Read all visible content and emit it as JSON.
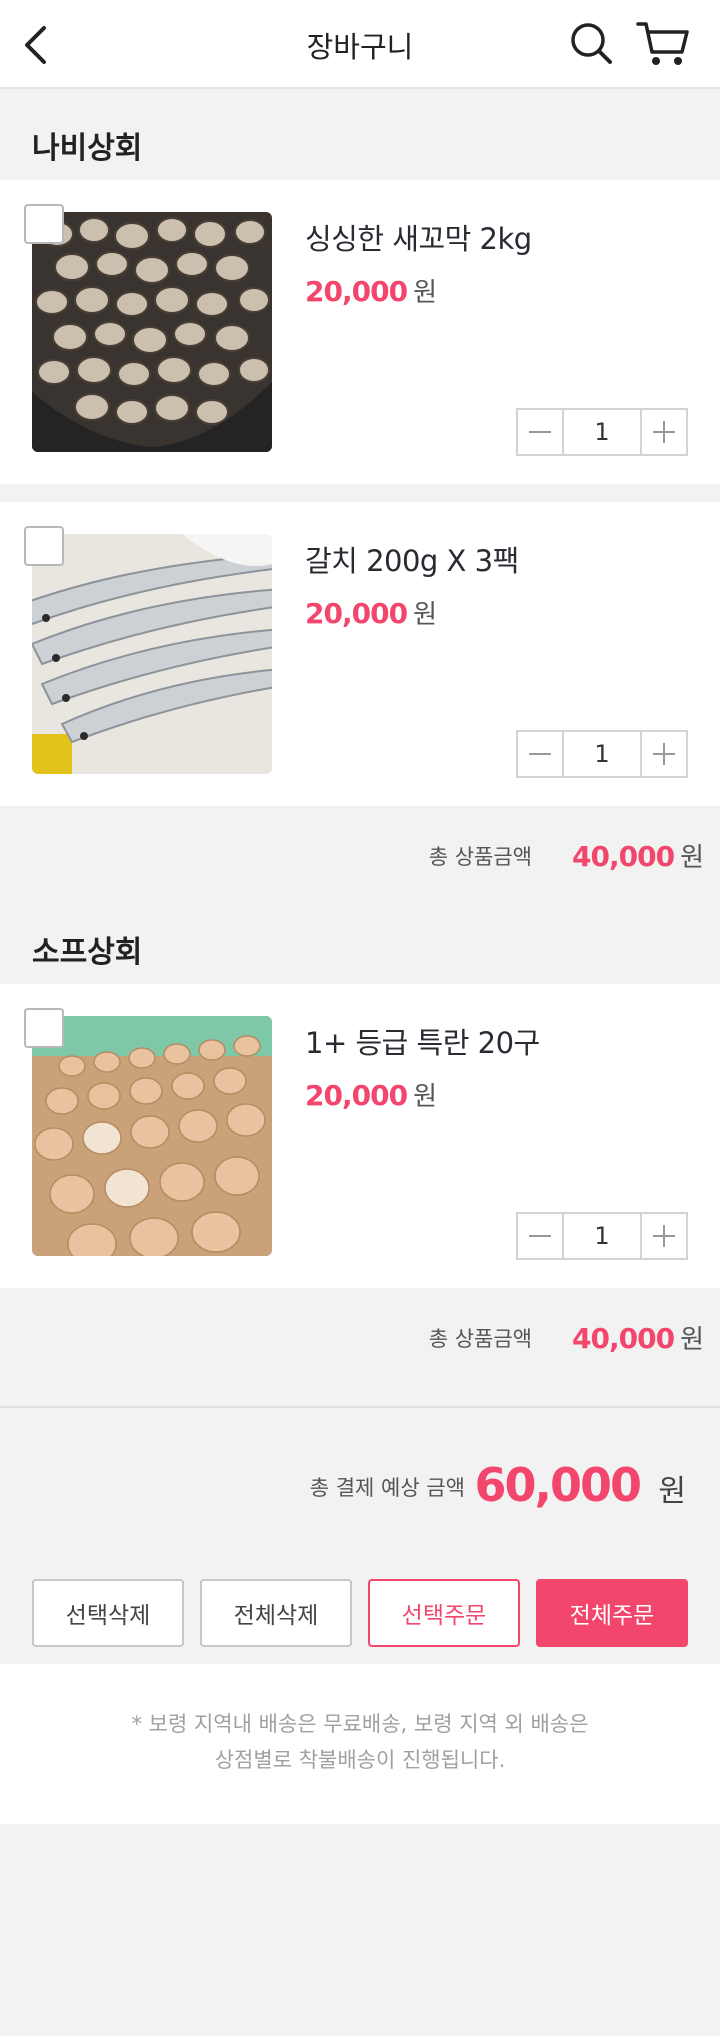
{
  "header": {
    "title": "장바구니"
  },
  "shops": [
    {
      "name": "나비상회",
      "items": [
        {
          "name": "싱싱한 새꼬막 2kg",
          "price": "20,000",
          "unit": "원",
          "qty": "1"
        },
        {
          "name": "갈치 200g X 3팩",
          "price": "20,000",
          "unit": "원",
          "qty": "1"
        }
      ],
      "subtotal_label": "총 상품금액",
      "subtotal": "40,000",
      "subtotal_unit": "원"
    },
    {
      "name": "소프상회",
      "items": [
        {
          "name": "1+ 등급 특란 20구",
          "price": "20,000",
          "unit": "원",
          "qty": "1"
        }
      ],
      "subtotal_label": "총 상품금액",
      "subtotal": "40,000",
      "subtotal_unit": "원"
    }
  ],
  "total": {
    "label": "총 결제 예상 금액",
    "amount": "60,000",
    "unit": "원"
  },
  "actions": {
    "delete_selected": "선택삭제",
    "delete_all": "전체삭제",
    "order_selected": "선택주문",
    "order_all": "전체주문"
  },
  "notice": {
    "line1": "* 보령 지역내 배송은 무료배송, 보령 지역 외 배송은",
    "line2": "상점별로 착불배송이 진행됩니다."
  },
  "colors": {
    "accent": "#f2466d",
    "background": "#f2f2f2"
  }
}
